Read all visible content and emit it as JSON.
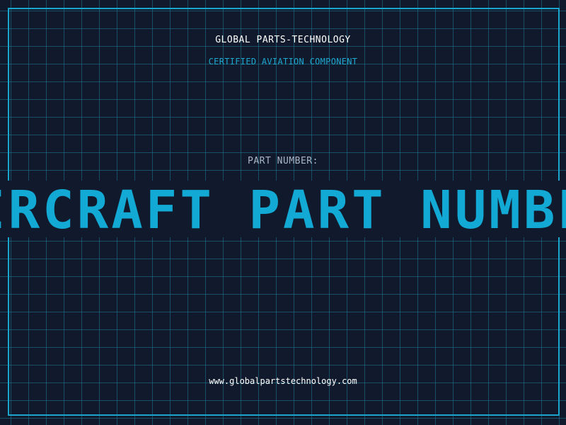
{
  "header": {
    "brand": "GLOBAL PARTS-TECHNOLOGY",
    "subtitle": "CERTIFIED AVIATION COMPONENT"
  },
  "part": {
    "label": "PART NUMBER:",
    "value": "AIRCRAFT PART NUMBER"
  },
  "footer": {
    "url": "www.globalpartstechnology.com"
  },
  "colors": {
    "background": "#111a2c",
    "grid": "#1e7896",
    "accent": "#12a9d4",
    "frame": "#1aa6cc"
  }
}
